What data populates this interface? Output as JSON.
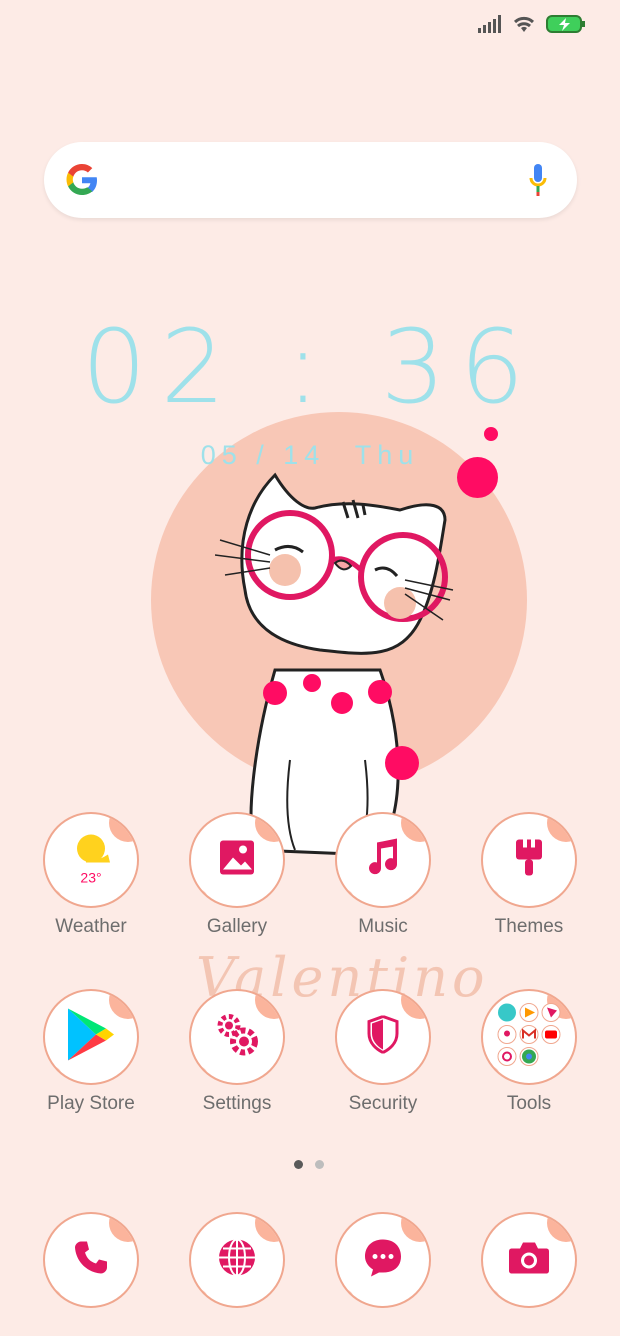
{
  "clock": {
    "time": "02 : 36"
  },
  "date": {
    "date": "05 / 14",
    "weekday": "Thu"
  },
  "wallpaper": {
    "signature": "Valentino"
  },
  "weather": {
    "temperature": "23°"
  },
  "apps_row1": [
    {
      "label": "Weather",
      "icon": "weather-icon"
    },
    {
      "label": "Gallery",
      "icon": "gallery-icon"
    },
    {
      "label": "Music",
      "icon": "music-icon"
    },
    {
      "label": "Themes",
      "icon": "themes-icon"
    }
  ],
  "apps_row2": [
    {
      "label": "Play Store",
      "icon": "play-store-icon"
    },
    {
      "label": "Settings",
      "icon": "settings-icon"
    },
    {
      "label": "Security",
      "icon": "security-icon"
    },
    {
      "label": "Tools",
      "icon": "tools-folder-icon"
    }
  ],
  "dock": [
    {
      "icon": "phone-icon"
    },
    {
      "icon": "browser-icon"
    },
    {
      "icon": "messages-icon"
    },
    {
      "icon": "camera-icon"
    }
  ],
  "colors": {
    "accent": "#ff0c63",
    "clock": "#9ee1ea",
    "background": "#fdebe6",
    "ring": "#f0a78f"
  },
  "pager": {
    "pages": 2,
    "current": 1
  }
}
